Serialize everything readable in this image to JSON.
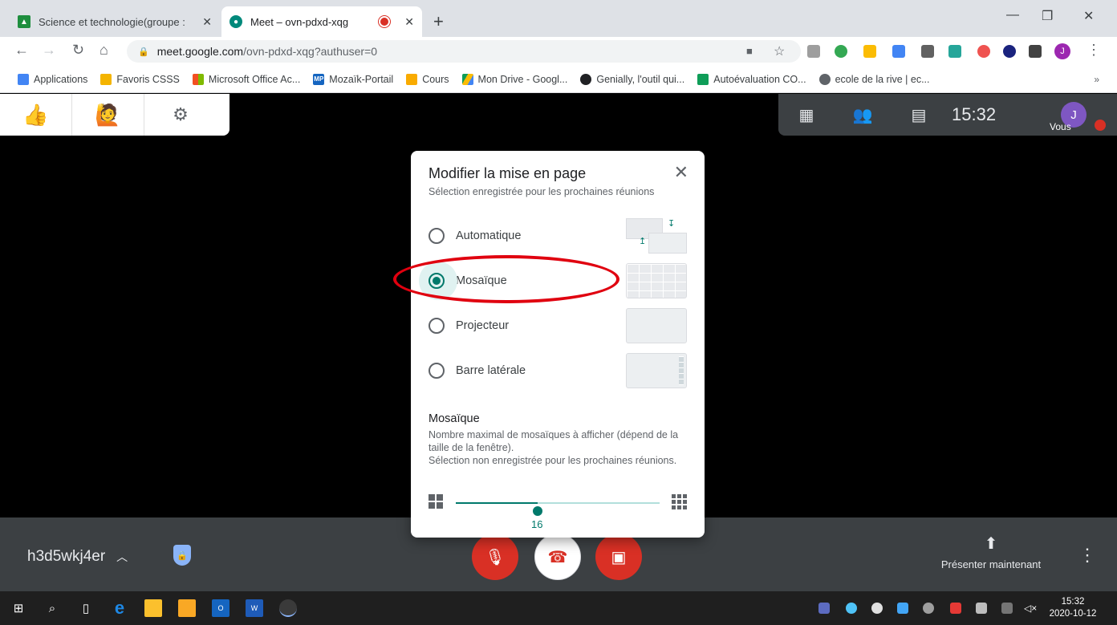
{
  "browser": {
    "tabs": [
      {
        "title": "Science et technologie(groupe : ",
        "active": false,
        "close": "✕",
        "icon": "google-classroom-icon",
        "color": "#1e8e3e"
      },
      {
        "title": "Meet – ovn-pdxd-xqg",
        "active": true,
        "close": "✕",
        "icon": "google-meet-icon",
        "color": "#00897b"
      }
    ],
    "new_tab": "+",
    "url_host": "meet.google.com",
    "url_path": "/ovn-pdxd-xqg?authuser=0",
    "profile_initial": "J",
    "bookmarks": [
      {
        "label": "Applications",
        "icon": "apps-grid-icon",
        "color": "#4285f4"
      },
      {
        "label": "Favoris CSSS",
        "icon": "folder-icon",
        "color": "#f4b400"
      },
      {
        "label": "Microsoft Office Ac...",
        "icon": "microsoft-icon",
        "color": "#f25022"
      },
      {
        "label": "Mozaïk-Portail",
        "icon": "mozaik-icon",
        "color": "#1565c0",
        "badge": "MP"
      },
      {
        "label": "Cours",
        "icon": "classroom-icon",
        "color": "#f9ab00"
      },
      {
        "label": "Mon Drive - Googl...",
        "icon": "google-drive-icon",
        "color": "#0f9d58"
      },
      {
        "label": "Genially, l'outil qui...",
        "icon": "genially-icon",
        "color": "#202124"
      },
      {
        "label": "Autoévaluation CO...",
        "icon": "sheets-icon",
        "color": "#0f9d58"
      },
      {
        "label": "ecole de la rive | ec...",
        "icon": "globe-icon",
        "color": "#5f6368"
      }
    ],
    "bookmarks_more": "»"
  },
  "meet": {
    "clock": "15:32",
    "you_label": "Vous",
    "you_initial": "J",
    "meeting_code": "h3d5wkj4er",
    "present_label": "Présenter maintenant"
  },
  "dialog": {
    "title": "Modifier la mise en page",
    "subtitle": "Sélection enregistrée pour les prochaines réunions",
    "options": [
      {
        "label": "Automatique",
        "selected": false
      },
      {
        "label": "Mosaïque",
        "selected": true
      },
      {
        "label": "Projecteur",
        "selected": false
      },
      {
        "label": "Barre latérale",
        "selected": false
      }
    ],
    "tiles_heading": "Mosaïque",
    "tiles_desc_1": "Nombre maximal de mosaïques à afficher (dépend de la taille de la fenêtre).",
    "tiles_desc_2": "Sélection non enregistrée pour les prochaines réunions.",
    "tiles_value": "16",
    "tiles_fraction": 0.4
  },
  "taskbar": {
    "time": "15:32",
    "date": "2020-10-12"
  },
  "colors": {
    "accent": "#00796b",
    "meet_red": "#d93025",
    "annotation": "#e0000f"
  }
}
